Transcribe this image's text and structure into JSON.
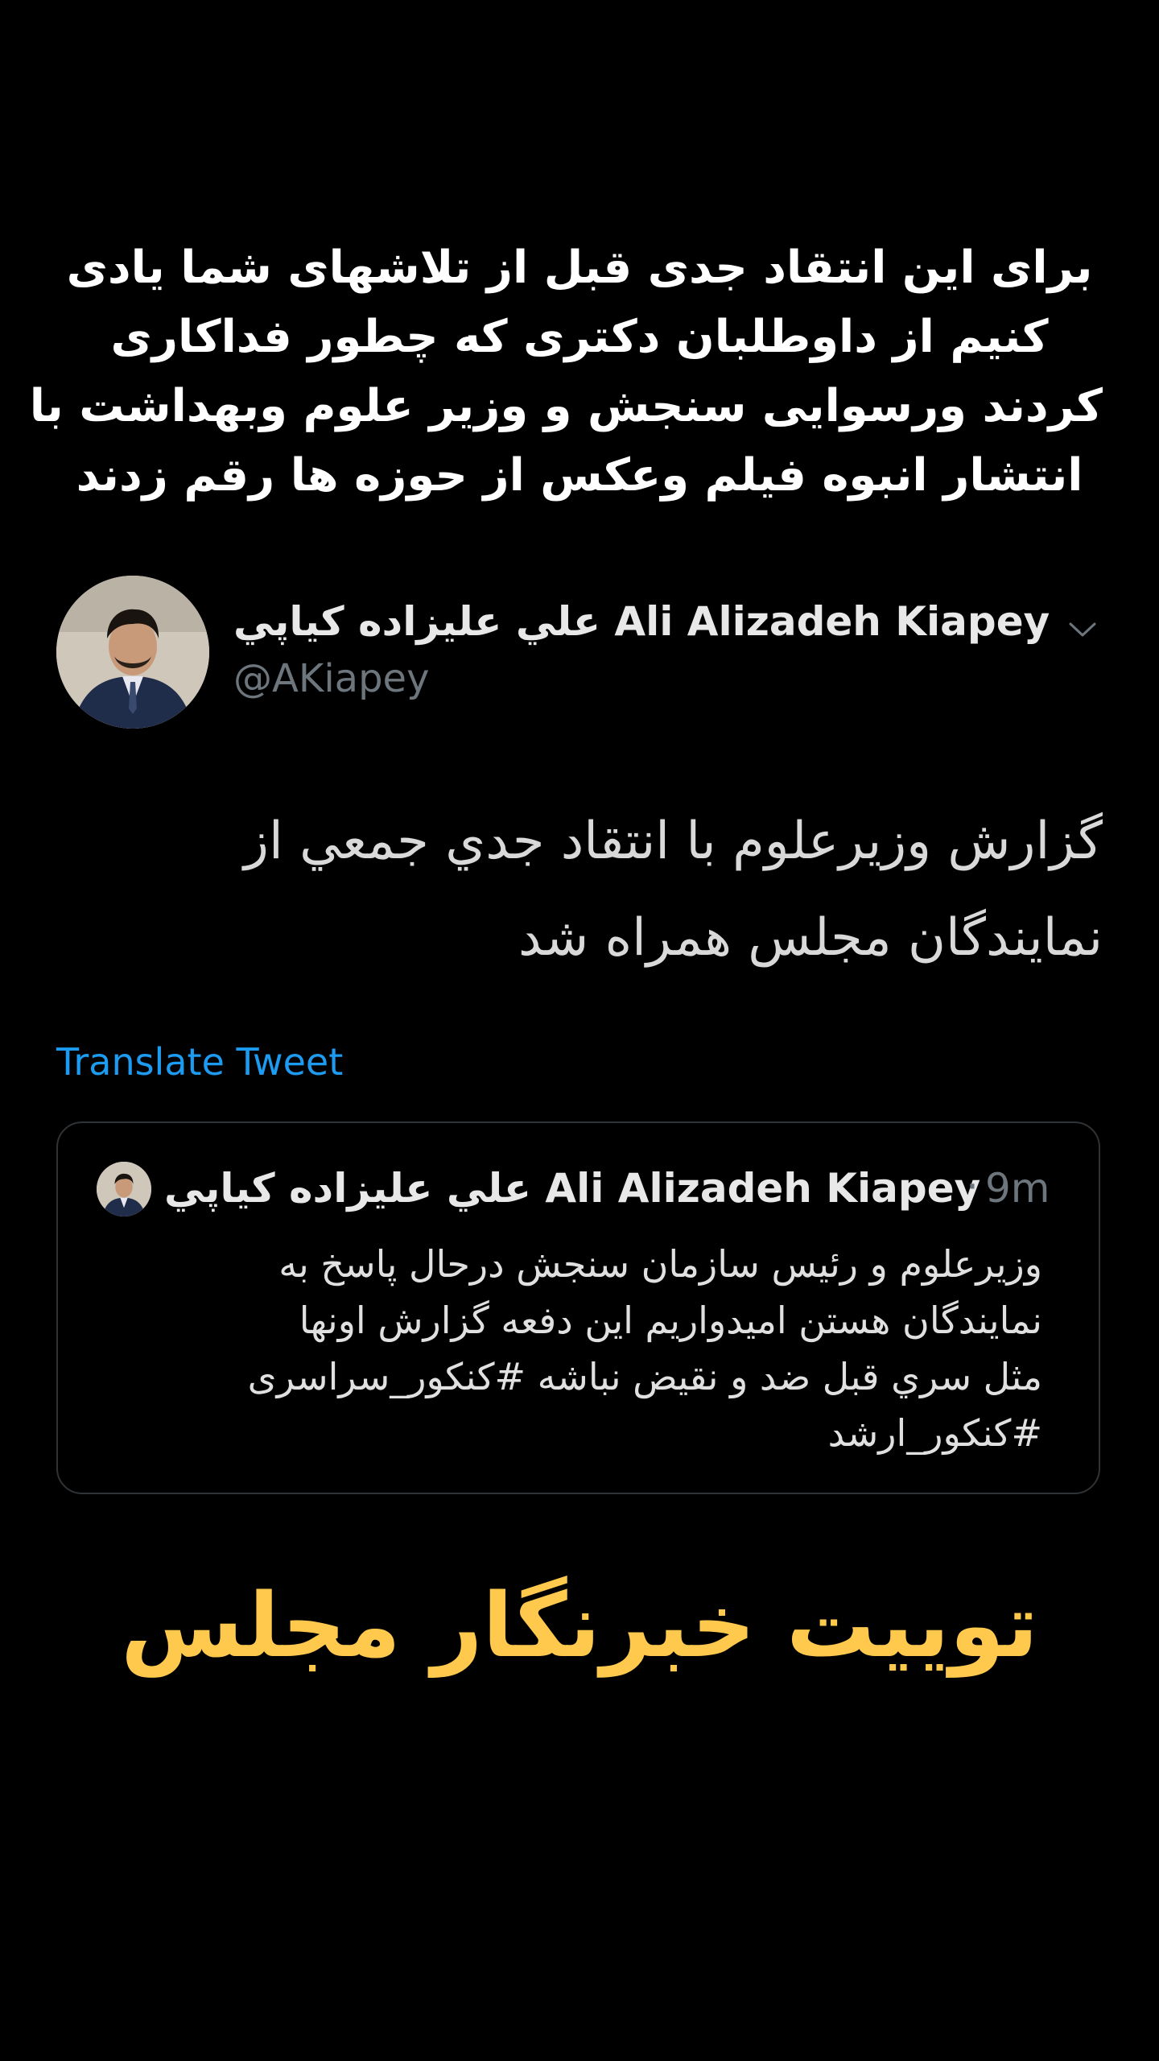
{
  "headline": {
    "lines": [
      "برای این انتقاد جدی قبل از تلاشهای شما یادی",
      "کنیم از داوطلبان دکتری که چطور فداکاری",
      "کردند ورسوایی سنجش و وزیر علوم وبهداشت با",
      "انتشار انبوه فیلم وعکس از حوزه ها رقم زدند"
    ]
  },
  "tweet": {
    "display_name": "علي عليزاده كياپي Ali Alizadeh Kiapey",
    "handle": "@AKiapey",
    "text_lines": [
      "گزارش وزيرعلوم با انتقاد جدي جمعي از",
      "نمايندگان مجلس همراه شد"
    ],
    "translate_label": "Translate Tweet"
  },
  "quote": {
    "display_name": "علي عليزاده كياپي Ali Alizadeh Kiapey",
    "separator": "·",
    "time": "9m",
    "text_lines": [
      "وزيرعلوم و رئيس سازمان سنجش درحال پاسخ به",
      "نمايندگان هستن اميدواريم اين دفعه گزارش اونها",
      "مثل سري قبل ضد و نقيض نباشه #كنكور_سراسری",
      "#كنكور_ارشد"
    ]
  },
  "caption": {
    "text": "توییت خبرنگار مجلس"
  },
  "icons": {
    "avatar": "profile-photo-icon",
    "chevron": "chevron-down-icon",
    "quote_avatar": "profile-photo-icon"
  },
  "colors": {
    "background": "#000000",
    "link": "#1d9bf0",
    "caption": "#ffc94d",
    "muted": "#6e767d",
    "border": "#2f3336"
  }
}
